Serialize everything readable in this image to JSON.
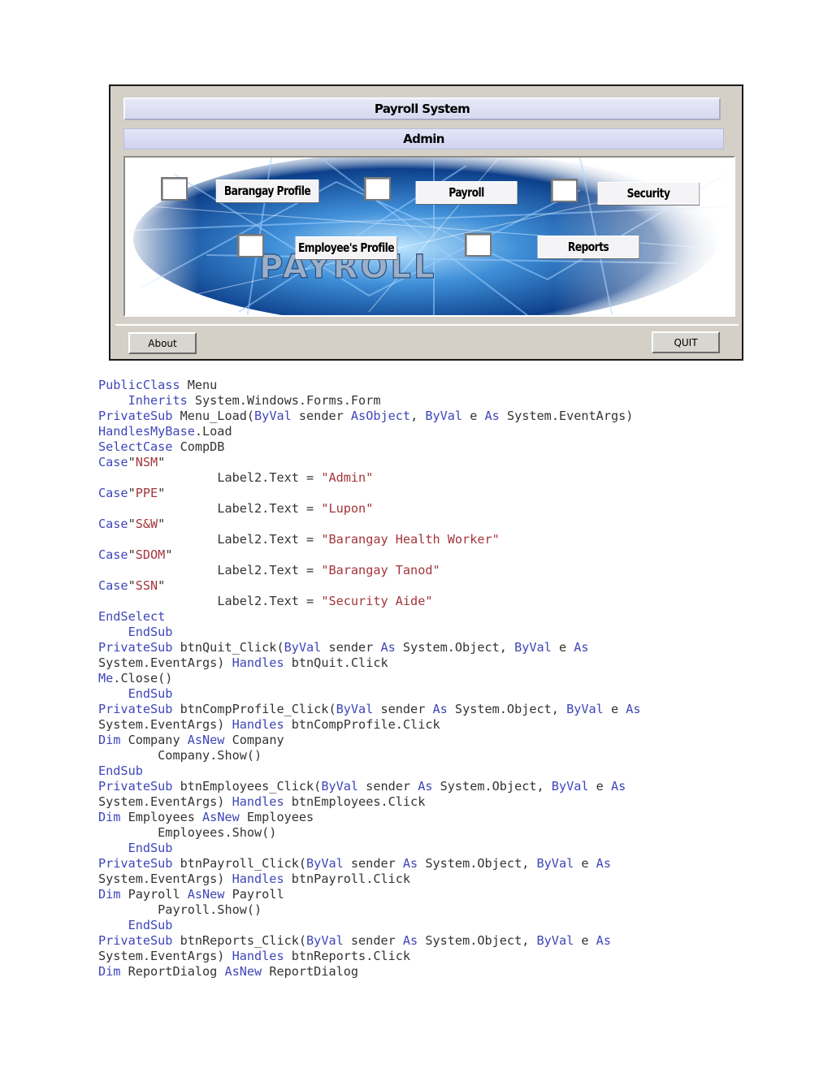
{
  "form": {
    "title": "Payroll System",
    "subtitle": "Admin",
    "logo_text": "PAYROLL",
    "menu_buttons": [
      "Barangay Profile",
      "Payroll",
      "Security",
      "Employee's Profile",
      "Reports"
    ],
    "about_button": "About",
    "quit_button": "QUIT"
  },
  "code_lines": [
    {
      "indent": "",
      "parts": [
        {
          "t": "PublicClass",
          "k": "kw"
        },
        {
          "t": " Menu",
          "k": ""
        }
      ]
    },
    {
      "indent": "    ",
      "parts": [
        {
          "t": "Inherits",
          "k": "kw"
        },
        {
          "t": " System.Windows.Forms.Form",
          "k": ""
        }
      ]
    },
    {
      "indent": "",
      "parts": [
        {
          "t": "PrivateSub",
          "k": "kw"
        },
        {
          "t": " Menu_Load(",
          "k": ""
        },
        {
          "t": "ByVal",
          "k": "kw"
        },
        {
          "t": " sender ",
          "k": ""
        },
        {
          "t": "AsObject",
          "k": "kw"
        },
        {
          "t": ", ",
          "k": ""
        },
        {
          "t": "ByVal",
          "k": "kw"
        },
        {
          "t": " e ",
          "k": ""
        },
        {
          "t": "As",
          "k": "kw"
        },
        {
          "t": " System.EventArgs)",
          "k": ""
        }
      ]
    },
    {
      "indent": "",
      "parts": [
        {
          "t": "HandlesMyBase",
          "k": "kw"
        },
        {
          "t": ".Load",
          "k": ""
        }
      ]
    },
    {
      "indent": "",
      "parts": [
        {
          "t": "SelectCase",
          "k": "kw"
        },
        {
          "t": " CompDB",
          "k": ""
        }
      ]
    },
    {
      "indent": "",
      "parts": [
        {
          "t": "Case",
          "k": "kw"
        },
        {
          "t": "\"",
          "k": ""
        },
        {
          "t": "NSM",
          "k": "st"
        },
        {
          "t": "\"",
          "k": ""
        }
      ]
    },
    {
      "indent": "                ",
      "parts": [
        {
          "t": "Label2.Text = ",
          "k": ""
        },
        {
          "t": "\"Admin\"",
          "k": "st"
        }
      ]
    },
    {
      "indent": "",
      "parts": [
        {
          "t": "Case",
          "k": "kw"
        },
        {
          "t": "\"",
          "k": ""
        },
        {
          "t": "PPE",
          "k": "st"
        },
        {
          "t": "\"",
          "k": ""
        }
      ]
    },
    {
      "indent": "                ",
      "parts": [
        {
          "t": "Label2.Text = ",
          "k": ""
        },
        {
          "t": "\"Lupon\"",
          "k": "st"
        }
      ]
    },
    {
      "indent": "",
      "parts": [
        {
          "t": "Case",
          "k": "kw"
        },
        {
          "t": "\"",
          "k": ""
        },
        {
          "t": "S&W",
          "k": "st"
        },
        {
          "t": "\"",
          "k": ""
        }
      ]
    },
    {
      "indent": "                ",
      "parts": [
        {
          "t": "Label2.Text = ",
          "k": ""
        },
        {
          "t": "\"Barangay Health Worker\"",
          "k": "st"
        }
      ]
    },
    {
      "indent": "",
      "parts": [
        {
          "t": "Case",
          "k": "kw"
        },
        {
          "t": "\"",
          "k": ""
        },
        {
          "t": "SDOM",
          "k": "st"
        },
        {
          "t": "\"",
          "k": ""
        }
      ]
    },
    {
      "indent": "                ",
      "parts": [
        {
          "t": "Label2.Text = ",
          "k": ""
        },
        {
          "t": "\"Barangay Tanod\"",
          "k": "st"
        }
      ]
    },
    {
      "indent": "",
      "parts": [
        {
          "t": "Case",
          "k": "kw"
        },
        {
          "t": "\"",
          "k": ""
        },
        {
          "t": "SSN",
          "k": "st"
        },
        {
          "t": "\"",
          "k": ""
        }
      ]
    },
    {
      "indent": "                ",
      "parts": [
        {
          "t": "Label2.Text = ",
          "k": ""
        },
        {
          "t": "\"Security Aide\"",
          "k": "st"
        }
      ]
    },
    {
      "indent": "",
      "parts": [
        {
          "t": "EndSelect",
          "k": "kw"
        }
      ]
    },
    {
      "indent": "    ",
      "parts": [
        {
          "t": "EndSub",
          "k": "kw"
        }
      ]
    },
    {
      "indent": "",
      "parts": [
        {
          "t": "PrivateSub",
          "k": "kw"
        },
        {
          "t": " btnQuit_Click(",
          "k": ""
        },
        {
          "t": "ByVal",
          "k": "kw"
        },
        {
          "t": " sender ",
          "k": ""
        },
        {
          "t": "As",
          "k": "kw"
        },
        {
          "t": " System.Object, ",
          "k": ""
        },
        {
          "t": "ByVal",
          "k": "kw"
        },
        {
          "t": " e ",
          "k": ""
        },
        {
          "t": "As",
          "k": "kw"
        }
      ]
    },
    {
      "indent": "",
      "parts": [
        {
          "t": "System.EventArgs) ",
          "k": ""
        },
        {
          "t": "Handles",
          "k": "kw"
        },
        {
          "t": " btnQuit.Click",
          "k": ""
        }
      ]
    },
    {
      "indent": "",
      "parts": [
        {
          "t": "Me",
          "k": "kw"
        },
        {
          "t": ".Close()",
          "k": ""
        }
      ]
    },
    {
      "indent": "    ",
      "parts": [
        {
          "t": "EndSub",
          "k": "kw"
        }
      ]
    },
    {
      "indent": "",
      "parts": [
        {
          "t": "PrivateSub",
          "k": "kw"
        },
        {
          "t": " btnCompProfile_Click(",
          "k": ""
        },
        {
          "t": "ByVal",
          "k": "kw"
        },
        {
          "t": " sender ",
          "k": ""
        },
        {
          "t": "As",
          "k": "kw"
        },
        {
          "t": " System.Object, ",
          "k": ""
        },
        {
          "t": "ByVal",
          "k": "kw"
        },
        {
          "t": " e ",
          "k": ""
        },
        {
          "t": "As",
          "k": "kw"
        }
      ]
    },
    {
      "indent": "",
      "parts": [
        {
          "t": "System.EventArgs) ",
          "k": ""
        },
        {
          "t": "Handles",
          "k": "kw"
        },
        {
          "t": " btnCompProfile.Click",
          "k": ""
        }
      ]
    },
    {
      "indent": "",
      "parts": [
        {
          "t": "Dim",
          "k": "kw"
        },
        {
          "t": " Company ",
          "k": ""
        },
        {
          "t": "AsNew",
          "k": "kw"
        },
        {
          "t": " Company",
          "k": ""
        }
      ]
    },
    {
      "indent": "        ",
      "parts": [
        {
          "t": "Company.Show()",
          "k": ""
        }
      ]
    },
    {
      "indent": "",
      "parts": [
        {
          "t": "EndSub",
          "k": "kw"
        }
      ]
    },
    {
      "indent": "",
      "parts": [
        {
          "t": "PrivateSub",
          "k": "kw"
        },
        {
          "t": " btnEmployees_Click(",
          "k": ""
        },
        {
          "t": "ByVal",
          "k": "kw"
        },
        {
          "t": " sender ",
          "k": ""
        },
        {
          "t": "As",
          "k": "kw"
        },
        {
          "t": " System.Object, ",
          "k": ""
        },
        {
          "t": "ByVal",
          "k": "kw"
        },
        {
          "t": " e ",
          "k": ""
        },
        {
          "t": "As",
          "k": "kw"
        }
      ]
    },
    {
      "indent": "",
      "parts": [
        {
          "t": "System.EventArgs) ",
          "k": ""
        },
        {
          "t": "Handles",
          "k": "kw"
        },
        {
          "t": " btnEmployees.Click",
          "k": ""
        }
      ]
    },
    {
      "indent": "",
      "parts": [
        {
          "t": "Dim",
          "k": "kw"
        },
        {
          "t": " Employees ",
          "k": ""
        },
        {
          "t": "AsNew",
          "k": "kw"
        },
        {
          "t": " Employees",
          "k": ""
        }
      ]
    },
    {
      "indent": "        ",
      "parts": [
        {
          "t": "Employees.Show()",
          "k": ""
        }
      ]
    },
    {
      "indent": "    ",
      "parts": [
        {
          "t": "EndSub",
          "k": "kw"
        }
      ]
    },
    {
      "indent": "",
      "parts": [
        {
          "t": "PrivateSub",
          "k": "kw"
        },
        {
          "t": " btnPayroll_Click(",
          "k": ""
        },
        {
          "t": "ByVal",
          "k": "kw"
        },
        {
          "t": " sender ",
          "k": ""
        },
        {
          "t": "As",
          "k": "kw"
        },
        {
          "t": " System.Object, ",
          "k": ""
        },
        {
          "t": "ByVal",
          "k": "kw"
        },
        {
          "t": " e ",
          "k": ""
        },
        {
          "t": "As",
          "k": "kw"
        }
      ]
    },
    {
      "indent": "",
      "parts": [
        {
          "t": "System.EventArgs) ",
          "k": ""
        },
        {
          "t": "Handles",
          "k": "kw"
        },
        {
          "t": " btnPayroll.Click",
          "k": ""
        }
      ]
    },
    {
      "indent": "",
      "parts": [
        {
          "t": "Dim",
          "k": "kw"
        },
        {
          "t": " Payroll ",
          "k": ""
        },
        {
          "t": "AsNew",
          "k": "kw"
        },
        {
          "t": " Payroll",
          "k": ""
        }
      ]
    },
    {
      "indent": "        ",
      "parts": [
        {
          "t": "Payroll.Show()",
          "k": ""
        }
      ]
    },
    {
      "indent": "    ",
      "parts": [
        {
          "t": "EndSub",
          "k": "kw"
        }
      ]
    },
    {
      "indent": "",
      "parts": [
        {
          "t": "PrivateSub",
          "k": "kw"
        },
        {
          "t": " btnReports_Click(",
          "k": ""
        },
        {
          "t": "ByVal",
          "k": "kw"
        },
        {
          "t": " sender ",
          "k": ""
        },
        {
          "t": "As",
          "k": "kw"
        },
        {
          "t": " System.Object, ",
          "k": ""
        },
        {
          "t": "ByVal",
          "k": "kw"
        },
        {
          "t": " e ",
          "k": ""
        },
        {
          "t": "As",
          "k": "kw"
        }
      ]
    },
    {
      "indent": "",
      "parts": [
        {
          "t": "System.EventArgs) ",
          "k": ""
        },
        {
          "t": "Handles",
          "k": "kw"
        },
        {
          "t": " btnReports.Click",
          "k": ""
        }
      ]
    },
    {
      "indent": "",
      "parts": [
        {
          "t": "Dim",
          "k": "kw"
        },
        {
          "t": " ReportDialog ",
          "k": ""
        },
        {
          "t": "AsNew",
          "k": "kw"
        },
        {
          "t": " ReportDialog",
          "k": ""
        }
      ]
    }
  ]
}
